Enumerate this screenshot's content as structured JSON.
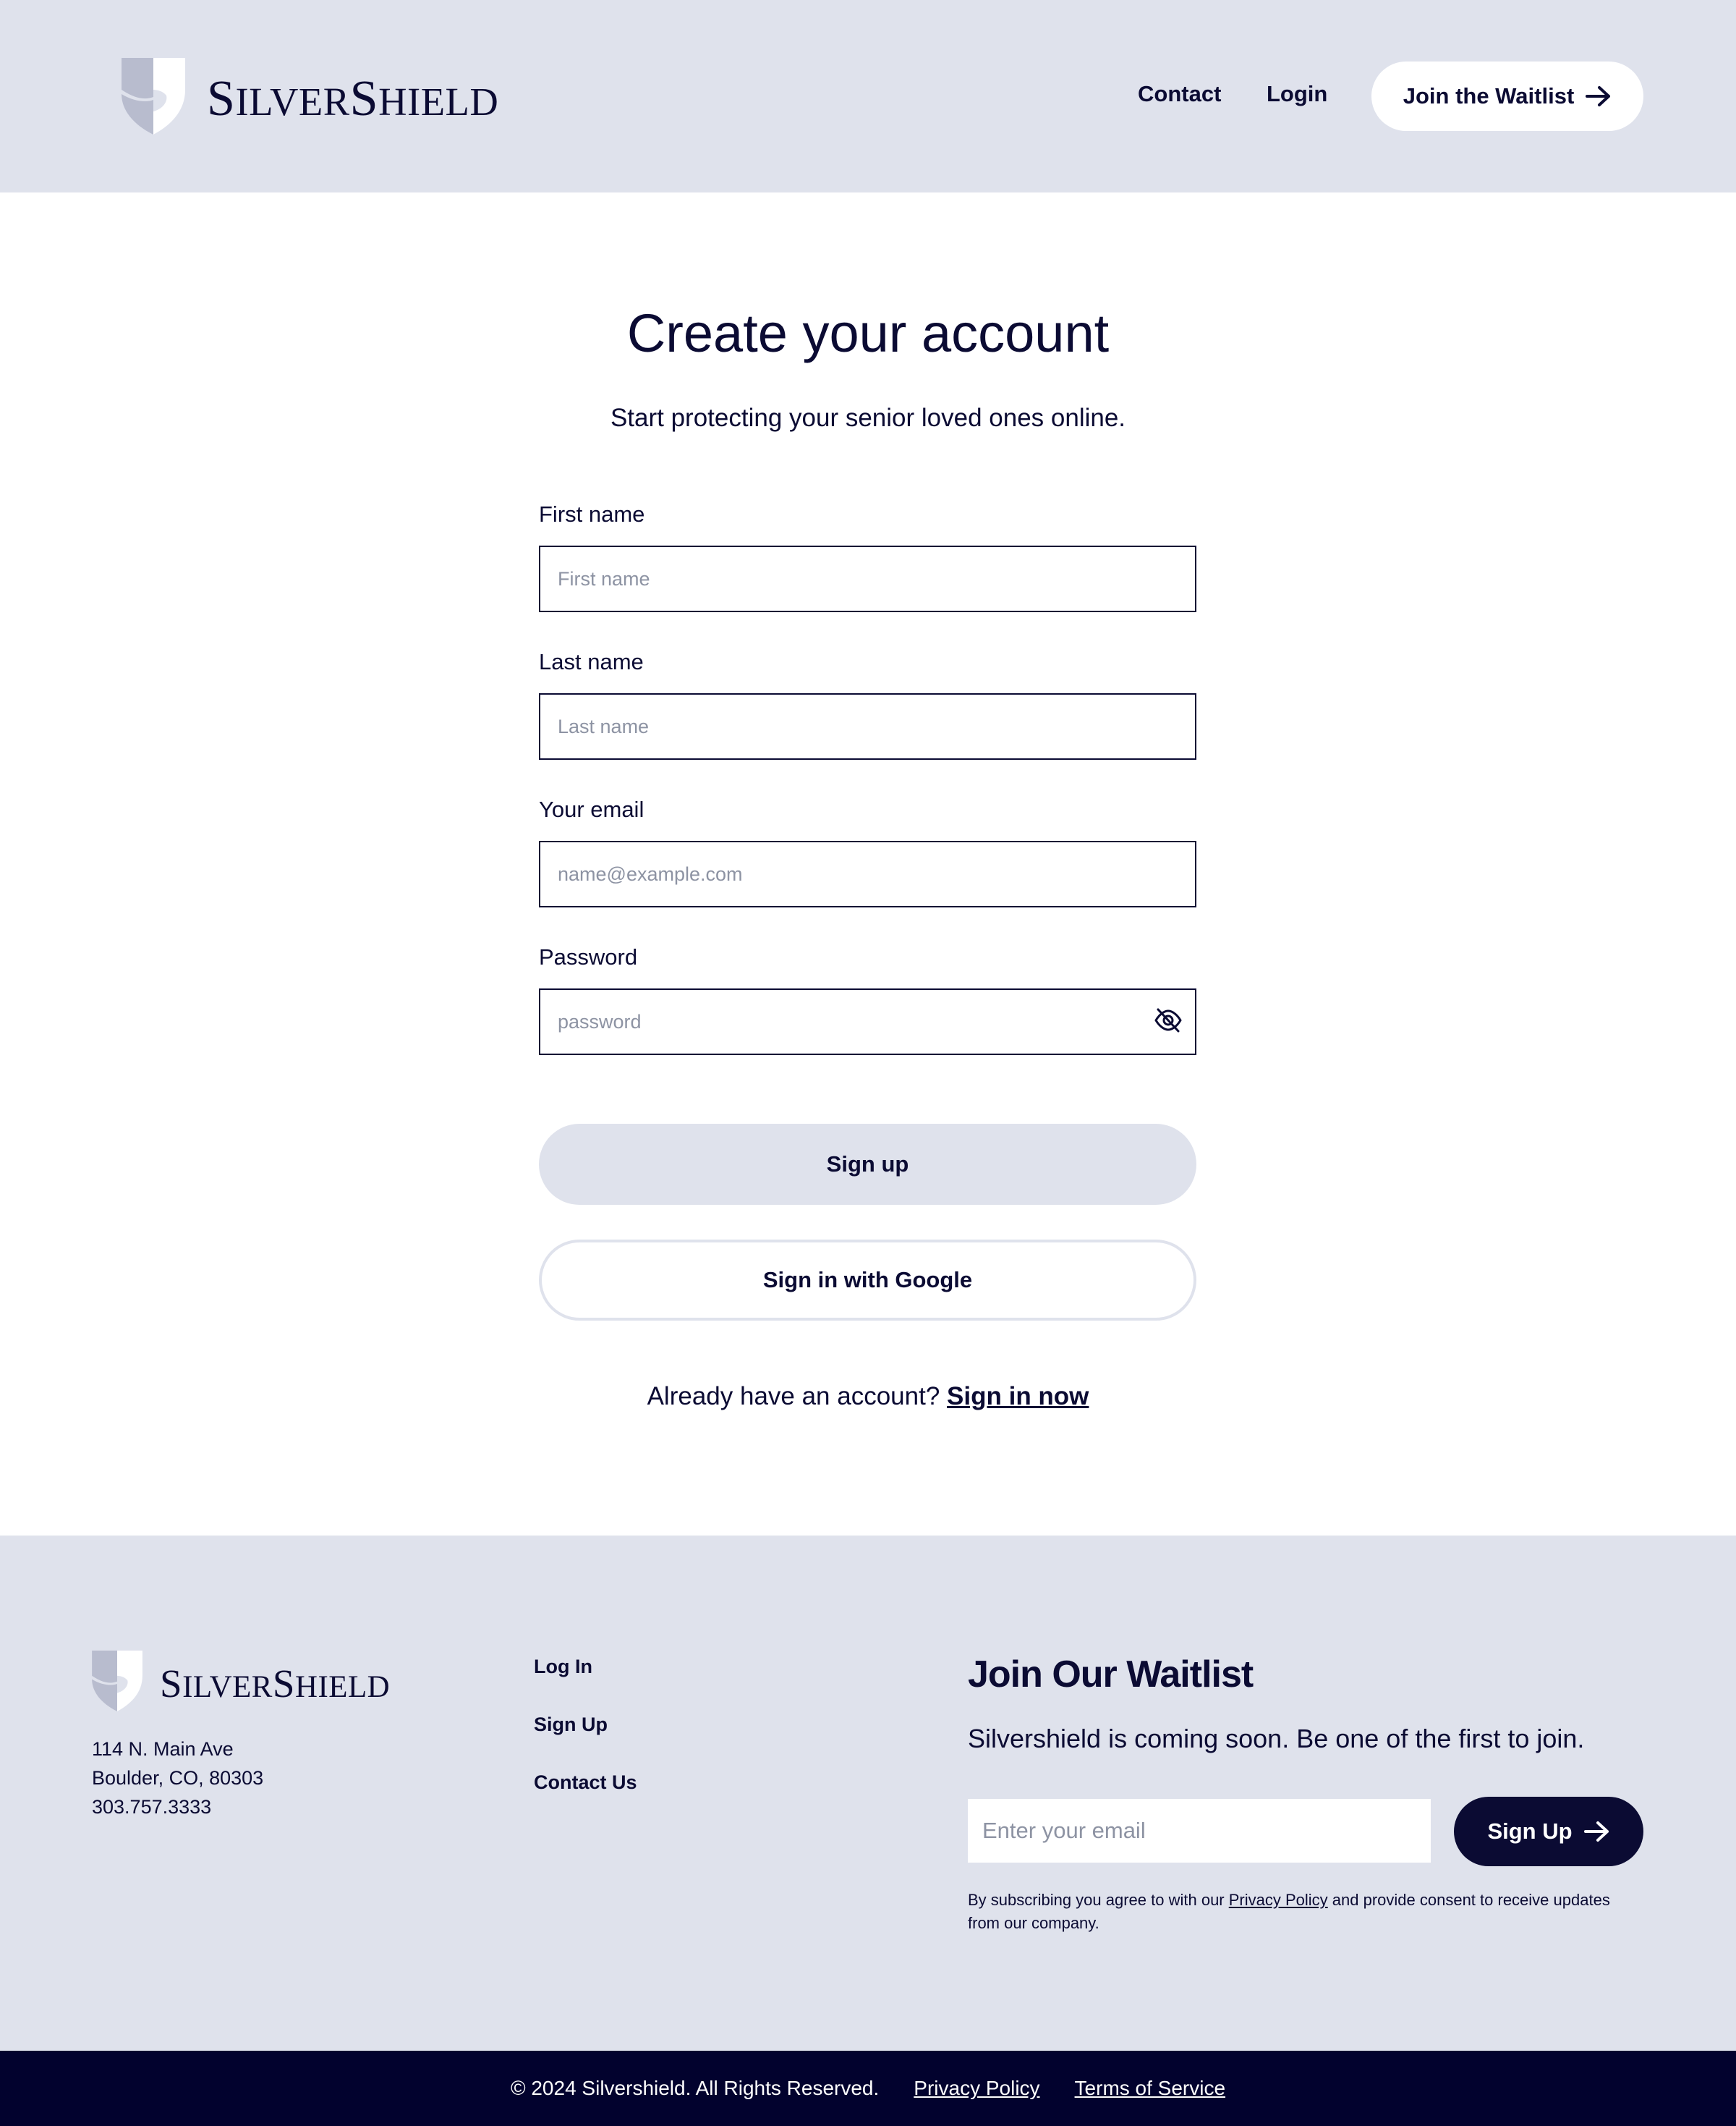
{
  "brand": {
    "name_first_cap": "S",
    "name_first_rest": "ILVER",
    "name_second_cap": "S",
    "name_second_rest": "HIELD",
    "color_primary": "#0b0b33",
    "color_soft": "#dfe2ec",
    "color_footer_bar": "#02022e"
  },
  "header": {
    "nav": {
      "contact": "Contact",
      "login": "Login"
    },
    "cta_label": "Join the Waitlist",
    "cta_icon": "arrow-right-icon"
  },
  "form": {
    "title": "Create your account",
    "subtitle": "Start protecting your senior loved ones online.",
    "first_name": {
      "label": "First name",
      "placeholder": "First name",
      "value": ""
    },
    "last_name": {
      "label": "Last name",
      "placeholder": "Last name",
      "value": ""
    },
    "email": {
      "label": "Your email",
      "placeholder": "name@example.com",
      "value": ""
    },
    "password": {
      "label": "Password",
      "placeholder": "password",
      "value": "",
      "toggle_icon": "eye-off-icon"
    },
    "signup_label": "Sign up",
    "google_label": "Sign in with Google",
    "already_text": "Already have an account?",
    "signin_link": "Sign in now"
  },
  "footer": {
    "address": {
      "line1": "114 N. Main Ave",
      "line2": "Boulder, CO, 80303",
      "phone": "303.757.3333"
    },
    "links": {
      "login": "Log In",
      "signup": "Sign Up",
      "contact": "Contact Us"
    },
    "waitlist": {
      "heading": "Join Our Waitlist",
      "subtext": "Silvershield is coming soon. Be one of the first to join.",
      "email_placeholder": "Enter your email",
      "button_label": "Sign Up",
      "consent_before": "By subscribing you agree to with our ",
      "consent_link": "Privacy Policy",
      "consent_after": " and provide consent to receive updates from our company."
    }
  },
  "bottom_bar": {
    "copyright": "© 2024 Silvershield. All Rights Reserved.",
    "privacy": "Privacy Policy",
    "terms": "Terms of Service"
  }
}
